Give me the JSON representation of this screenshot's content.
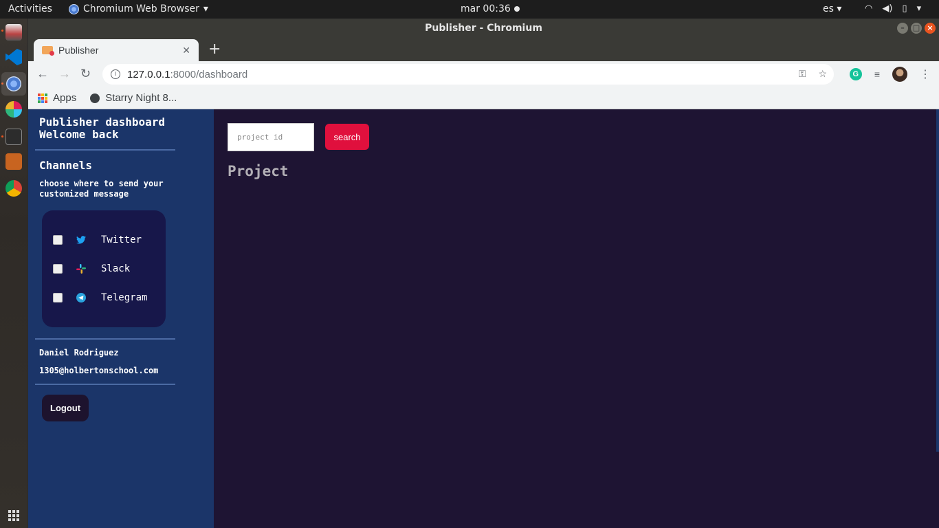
{
  "system": {
    "activities": "Activities",
    "app_name": "Chromium Web Browser",
    "clock": "mar 00:36",
    "language": "es"
  },
  "window": {
    "title": "Publisher - Chromium"
  },
  "tab": {
    "title": "Publisher"
  },
  "omnibox": {
    "url_host": "127.0.0.1",
    "url_path": ":8000/dashboard"
  },
  "bookmarks": {
    "apps": "Apps",
    "starry": "Starry Night 8..."
  },
  "sidebar": {
    "title_line1": "Publisher dashboard",
    "title_line2": "Welcome back",
    "channels_heading": "Channels",
    "channels_desc": "choose where to send your customized message",
    "channels": [
      {
        "label": "Twitter",
        "checked": false
      },
      {
        "label": "Slack",
        "checked": false
      },
      {
        "label": "Telegram",
        "checked": false
      }
    ],
    "user_name": "Daniel Rodriguez",
    "user_email": "1305@holbertonschool.com",
    "logout_label": "Logout"
  },
  "main": {
    "search_placeholder": "project id",
    "search_value": "",
    "search_button": "search",
    "project_heading": "Project"
  },
  "colors": {
    "sidebar_bg": "#1b3569",
    "main_bg": "#1e1433",
    "search_button": "#e0103d",
    "channel_box": "#17174a"
  }
}
